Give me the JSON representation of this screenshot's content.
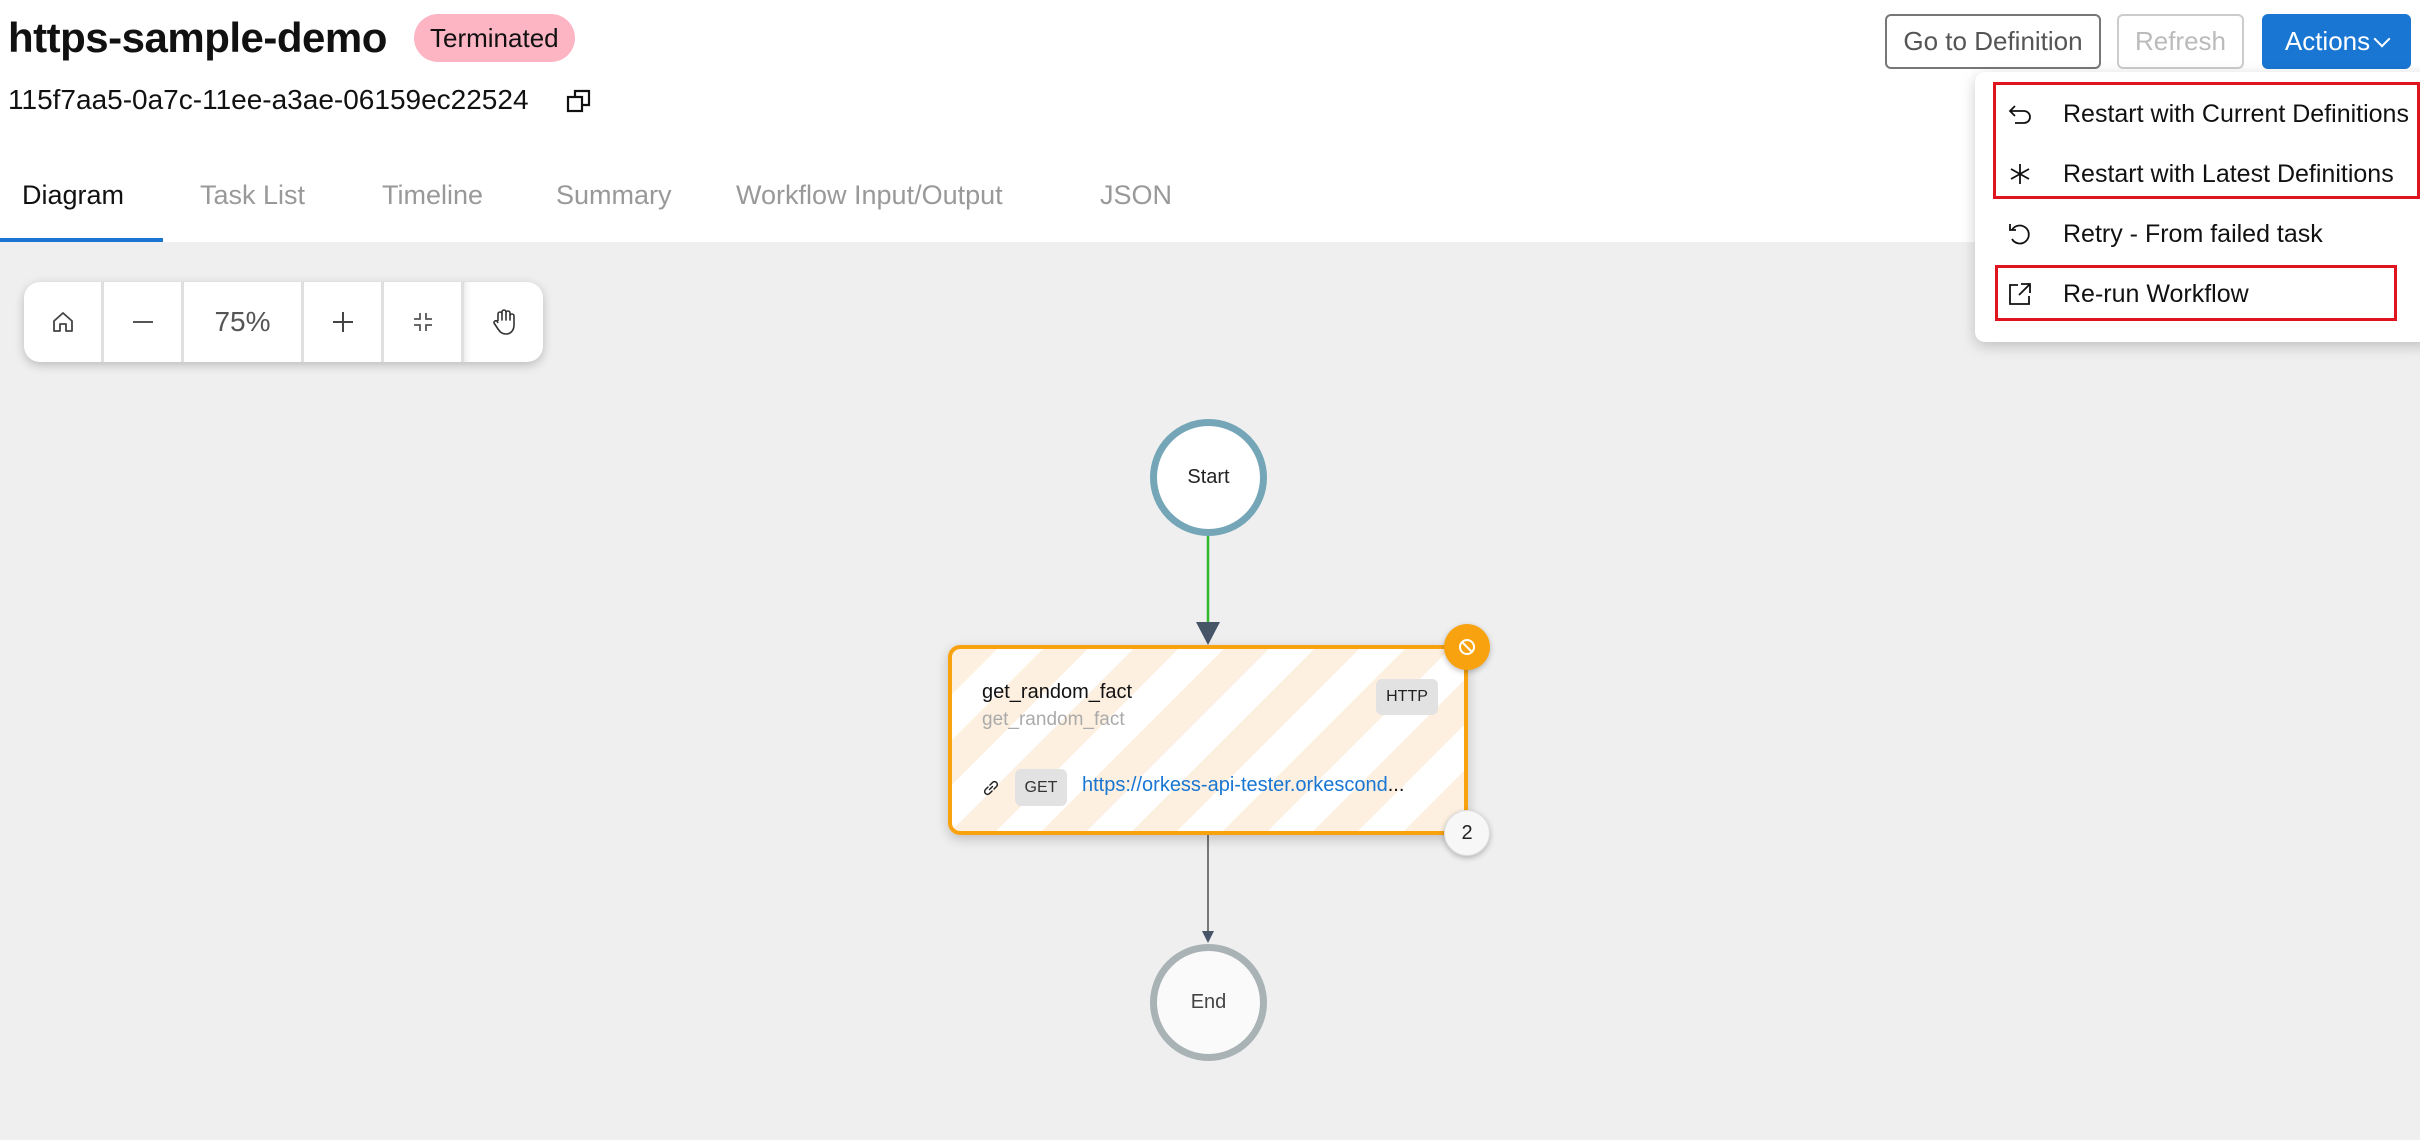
{
  "workflow": {
    "name": "https-sample-demo",
    "status": "Terminated",
    "status_color": "#fdb5c4",
    "id": "115f7aa5-0a7c-11ee-a3ae-06159ec22524"
  },
  "toolbar_actions": {
    "go_to_definition": "Go to Definition",
    "refresh": "Refresh",
    "actions": "Actions",
    "accent": "#1976d2"
  },
  "actions_menu": {
    "items": [
      {
        "label": "Restart with Current Definitions",
        "icon": "undo-arrow-icon",
        "highlighted": true
      },
      {
        "label": "Restart with Latest Definitions",
        "icon": "asterisk-icon",
        "highlighted": true
      },
      {
        "label": "Retry - From failed task",
        "icon": "retry-icon",
        "highlighted": false
      },
      {
        "label": "Re-run Workflow",
        "icon": "external-link-icon",
        "highlighted": true
      }
    ]
  },
  "tabs": [
    {
      "label": "Diagram",
      "active": true
    },
    {
      "label": "Task List",
      "active": false
    },
    {
      "label": "Timeline",
      "active": false
    },
    {
      "label": "Summary",
      "active": false
    },
    {
      "label": "Workflow Input/Output",
      "active": false
    },
    {
      "label": "JSON",
      "active": false
    }
  ],
  "zoom_controls": {
    "zoom_level": "75%",
    "buttons": [
      "home-icon",
      "zoom-out-icon",
      "zoom-in-icon",
      "fit-icon",
      "pan-hand-icon"
    ]
  },
  "diagram": {
    "start_label": "Start",
    "end_label": "End",
    "task": {
      "name": "get_random_fact",
      "reference": "get_random_fact",
      "type": "HTTP",
      "method": "GET",
      "url": "https://orkess-api-tester.orkescond",
      "url_ellipsis": "...",
      "attempts": "2",
      "status": "canceled",
      "status_color": "#f9a20f"
    }
  }
}
